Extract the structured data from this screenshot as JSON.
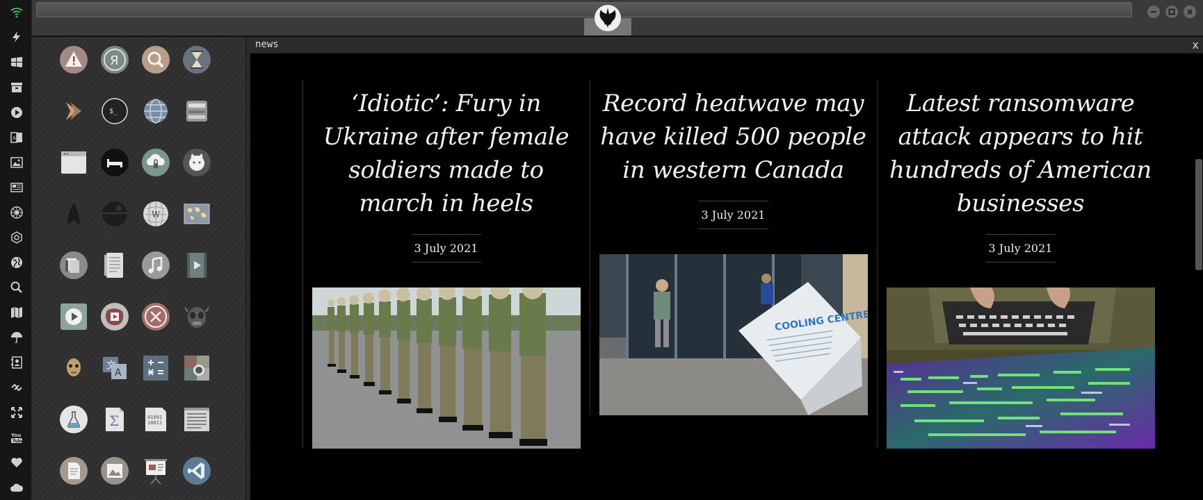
{
  "window": {
    "title": "news",
    "close_label": "x"
  },
  "dock": {
    "icons": [
      "wifi-icon",
      "bolt-icon",
      "windows-icon",
      "archive-icon",
      "play-circle-icon",
      "translate-book-icon",
      "image-icon",
      "newspaper-icon",
      "rebel-alliance-icon",
      "empire-icon",
      "globe-icon",
      "search-icon",
      "map-icon",
      "umbrella-icon",
      "contacts-icon",
      "link-icon",
      "expand-icon",
      "youtube-icon",
      "heart-icon",
      "cloud-icon"
    ]
  },
  "launcher": {
    "apps": [
      {
        "name": "warning-icon"
      },
      {
        "name": "yandex-icon"
      },
      {
        "name": "search-icon"
      },
      {
        "name": "hourglass-icon"
      },
      {
        "name": "terminal-chevron-icon"
      },
      {
        "name": "terminal-icon"
      },
      {
        "name": "globe-icon"
      },
      {
        "name": "printer-icon"
      },
      {
        "name": "window-icon"
      },
      {
        "name": "bed-icon"
      },
      {
        "name": "cloud-lock-icon"
      },
      {
        "name": "github-icon"
      },
      {
        "name": "starfleet-icon"
      },
      {
        "name": "death-star-icon"
      },
      {
        "name": "wikipedia-icon"
      },
      {
        "name": "world-map-icon"
      },
      {
        "name": "library-icon"
      },
      {
        "name": "document-icon"
      },
      {
        "name": "music-icon"
      },
      {
        "name": "video-icon"
      },
      {
        "name": "media-player-icon"
      },
      {
        "name": "video-rec-icon"
      },
      {
        "name": "close-circle-icon"
      },
      {
        "name": "alien-icon"
      },
      {
        "name": "c3po-icon"
      },
      {
        "name": "translate-icon"
      },
      {
        "name": "calculator-icon"
      },
      {
        "name": "camera-icon"
      },
      {
        "name": "science-icon"
      },
      {
        "name": "sigma-icon"
      },
      {
        "name": "binary-icon"
      },
      {
        "name": "text-editor-icon"
      },
      {
        "name": "file-icon"
      },
      {
        "name": "picture-viewer-icon"
      },
      {
        "name": "presentation-icon"
      },
      {
        "name": "vscode-icon"
      }
    ]
  },
  "articles": [
    {
      "title": "‘Idiotic’: Fury in Ukraine after female soldiers made to march in heels",
      "date": "3 July 2021"
    },
    {
      "title": "Record heatwave may have killed 500 people in western Canada",
      "date": "3 July 2021"
    },
    {
      "title": "Latest ransomware attack appears to hit hundreds of American businesses",
      "date": "3 July 2021"
    }
  ],
  "images": {
    "sign_title": "COOLING CENTRE"
  },
  "colors": {
    "dock_bg": "#161616",
    "dock_icon": "#cfcfcf",
    "wifi_accent": "#4caf50",
    "news_bg": "#000000"
  }
}
